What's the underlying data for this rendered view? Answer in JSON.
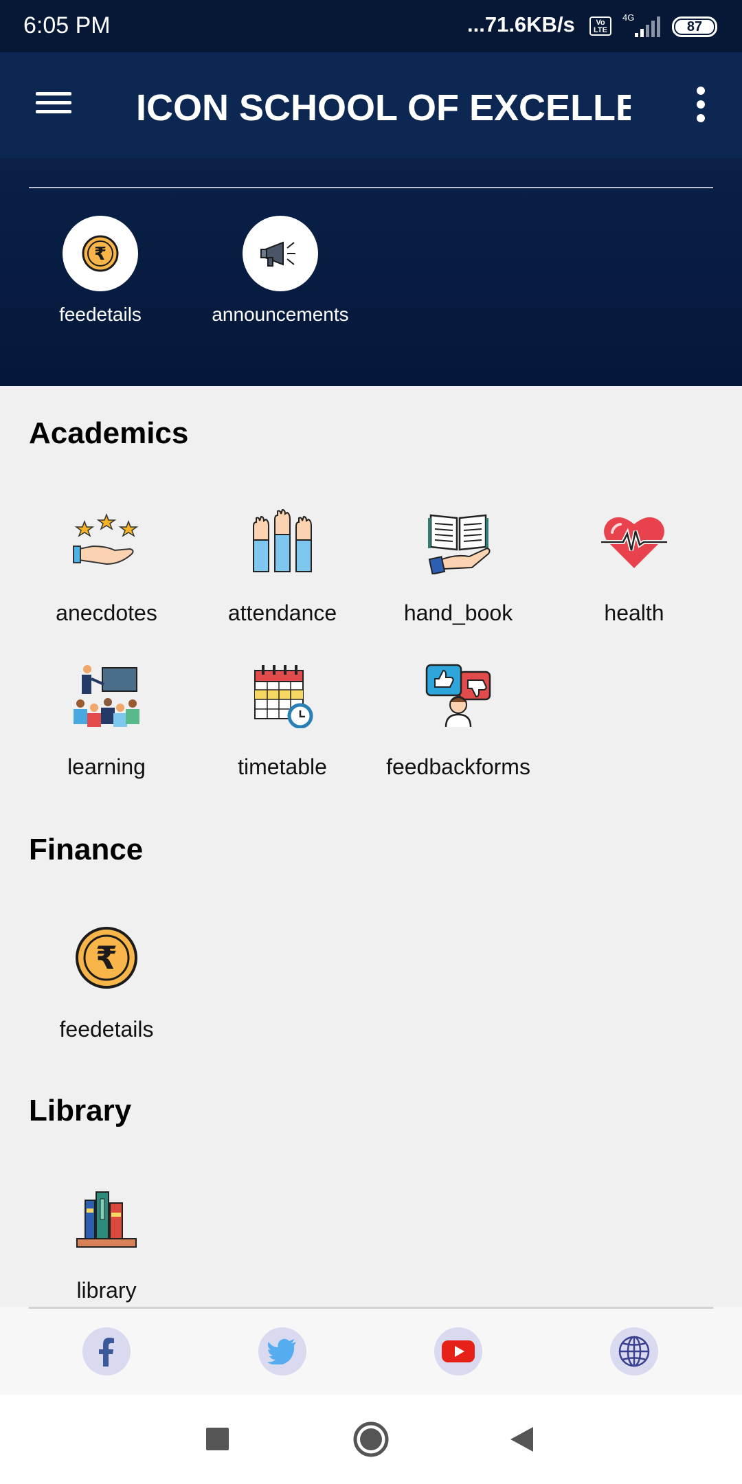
{
  "status_bar": {
    "time": "6:05 PM",
    "speed": "...71.6KB/s",
    "volte": "Vo LTE",
    "network": "4G",
    "battery": "87"
  },
  "app_bar": {
    "title": "ICON SCHOOL OF EXCELLE...",
    "color": "#0c2751"
  },
  "quick_links": [
    {
      "label": "feedetails",
      "icon": "rupee-coin-icon"
    },
    {
      "label": "announcements",
      "icon": "megaphone-icon"
    }
  ],
  "sections": {
    "academics": {
      "title": "Academics",
      "items": [
        {
          "label": "anecdotes",
          "icon": "stars-hand-icon"
        },
        {
          "label": "attendance",
          "icon": "raised-hands-icon"
        },
        {
          "label": "hand_book",
          "icon": "open-book-hand-icon"
        },
        {
          "label": "health",
          "icon": "heart-pulse-icon"
        },
        {
          "label": "learning",
          "icon": "classroom-icon"
        },
        {
          "label": "timetable",
          "icon": "calendar-clock-icon"
        },
        {
          "label": "feedbackforms",
          "icon": "feedback-thumbs-icon"
        }
      ]
    },
    "finance": {
      "title": "Finance",
      "items": [
        {
          "label": "feedetails",
          "icon": "rupee-coin-icon"
        }
      ]
    },
    "library": {
      "title": "Library",
      "items": [
        {
          "label": "library",
          "icon": "books-icon"
        }
      ]
    }
  },
  "social_links": [
    {
      "icon": "facebook-icon"
    },
    {
      "icon": "twitter-icon"
    },
    {
      "icon": "youtube-icon"
    },
    {
      "icon": "globe-icon"
    }
  ],
  "nav_bar": [
    {
      "icon": "recents-square-icon"
    },
    {
      "icon": "home-circle-icon"
    },
    {
      "icon": "back-triangle-icon"
    }
  ]
}
